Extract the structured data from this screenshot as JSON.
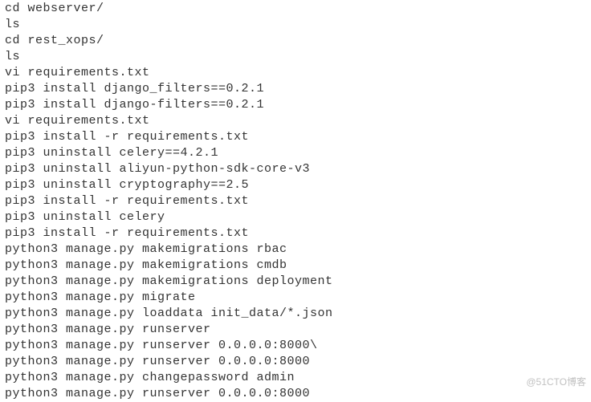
{
  "watermark": "@51CTO博客",
  "lines": [
    "cd webserver/",
    "ls",
    "cd rest_xops/",
    "ls",
    "vi requirements.txt",
    "pip3 install django_filters==0.2.1",
    "pip3 install django-filters==0.2.1",
    "vi requirements.txt",
    "pip3 install -r requirements.txt",
    "pip3 uninstall celery==4.2.1",
    "pip3 uninstall aliyun-python-sdk-core-v3",
    "pip3 uninstall cryptography==2.5",
    "pip3 install -r requirements.txt",
    "pip3 uninstall celery",
    "pip3 install -r requirements.txt",
    "python3 manage.py makemigrations rbac",
    "python3 manage.py makemigrations cmdb",
    "python3 manage.py makemigrations deployment",
    "python3 manage.py migrate",
    "python3 manage.py loaddata init_data/*.json",
    "python3 manage.py runserver",
    "python3 manage.py runserver 0.0.0.0:8000\\",
    "python3 manage.py runserver 0.0.0.0:8000",
    "python3 manage.py changepassword admin",
    "python3 manage.py runserver 0.0.0.0:8000"
  ]
}
